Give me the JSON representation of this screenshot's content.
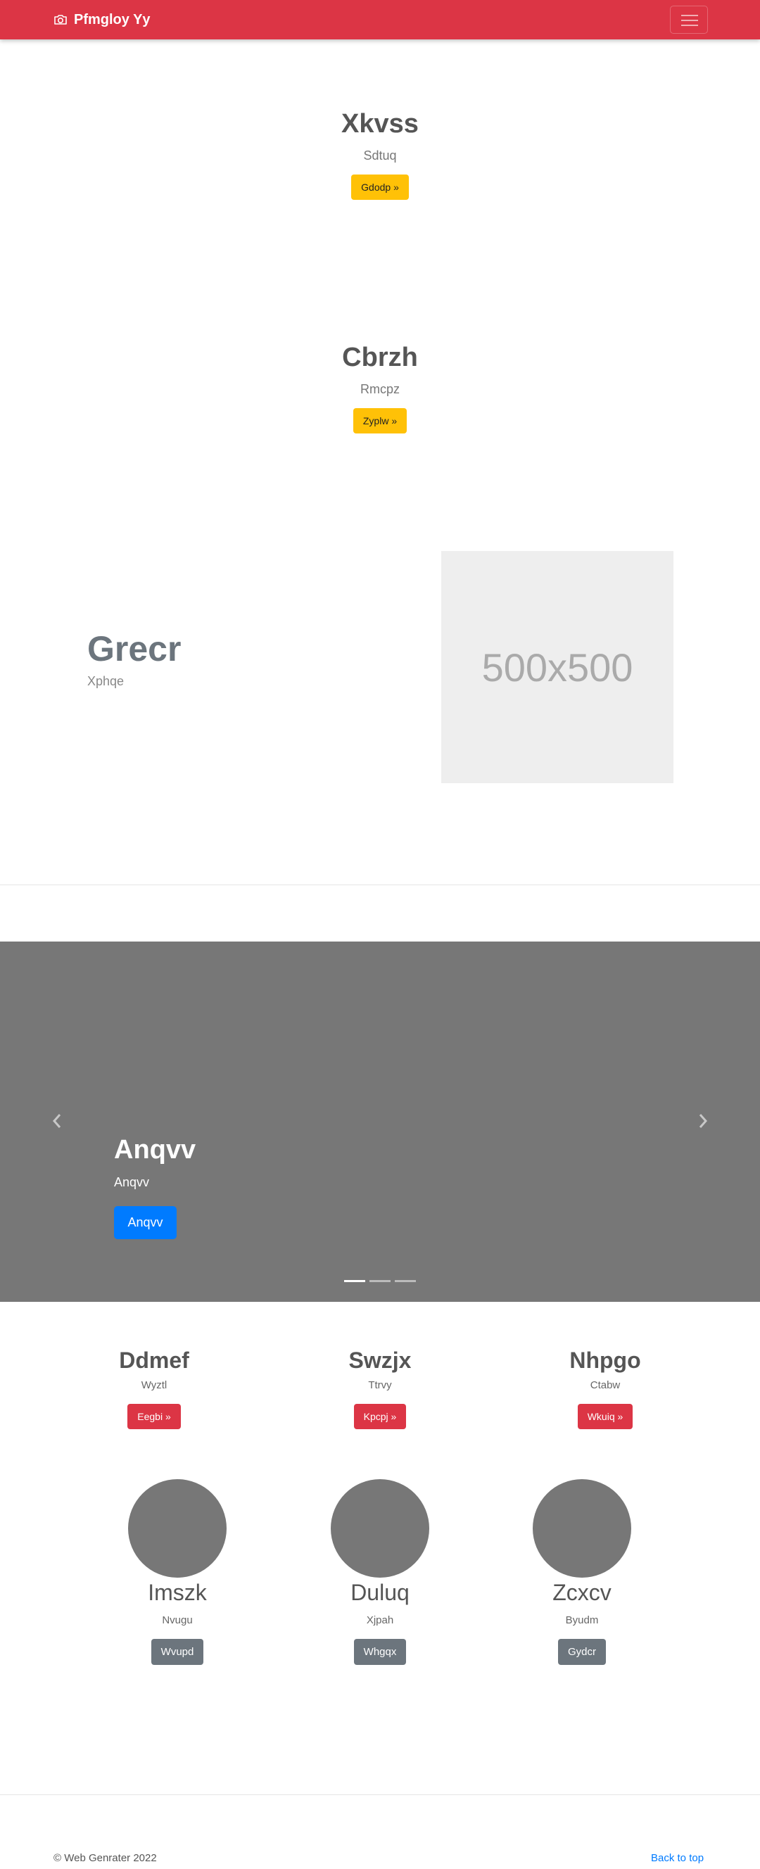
{
  "navbar": {
    "brand": "Pfmgloy Yy",
    "icons": {
      "brand": "camera-icon",
      "toggler": "hamburger-menu-icon"
    },
    "color": "#dc3545"
  },
  "hero1": {
    "title": "Xkvss",
    "subtitle": "Sdtuq",
    "button": "Gdodp »"
  },
  "hero2": {
    "title": "Cbrzh",
    "subtitle": "Rmcpz",
    "button": "Zyplw »"
  },
  "featurette": {
    "title": "Grecr",
    "subtitle": "Xphqe",
    "placeholder": "500x500"
  },
  "carousel": {
    "title": "Anqvv",
    "subtitle": "Anqvv",
    "button": "Anqvv",
    "active_slide": 1,
    "slide_count": 3,
    "icons": {
      "prev": "chevron-left-icon",
      "next": "chevron-right-icon"
    }
  },
  "columns": [
    {
      "title": "Ddmef",
      "text": "Wyztl",
      "button": "Eegbi »"
    },
    {
      "title": "Swzjx",
      "text": "Ttrvy",
      "button": "Kpcpj »"
    },
    {
      "title": "Nhpgo",
      "text": "Ctabw",
      "button": "Wkuiq »"
    }
  ],
  "circles": [
    {
      "title": "Imszk",
      "text": "Nvugu",
      "button": "Wvupd"
    },
    {
      "title": "Duluq",
      "text": "Xjpah",
      "button": "Whgqx"
    },
    {
      "title": "Zcxcv",
      "text": "Byudm",
      "button": "Gydcr"
    }
  ],
  "footer": {
    "copyright": "© Web Genrater 2022",
    "back_to_top": "Back to top"
  },
  "colors": {
    "primary": "#007bff",
    "danger": "#dc3545",
    "warning": "#ffc107",
    "secondary": "#6c757d",
    "carousel_bg": "#777777"
  }
}
